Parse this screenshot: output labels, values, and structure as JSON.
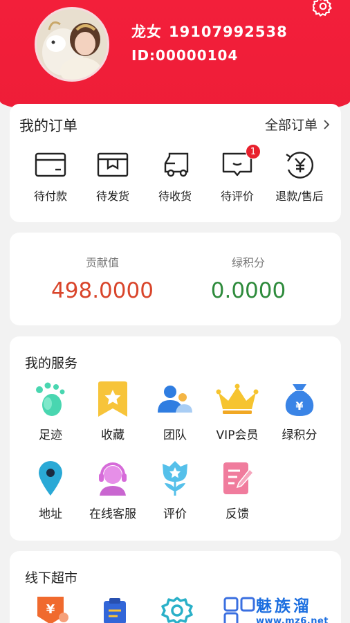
{
  "profile": {
    "name": "龙女",
    "phone": "19107992538",
    "id_text": "ID:00000104"
  },
  "orders": {
    "title": "我的订单",
    "all_label": "全部订单",
    "items": [
      {
        "label": "待付款",
        "icon": "wallet-icon"
      },
      {
        "label": "待发货",
        "icon": "package-icon"
      },
      {
        "label": "待收货",
        "icon": "truck-icon"
      },
      {
        "label": "待评价",
        "icon": "comment-icon",
        "badge": "1"
      },
      {
        "label": "退款/售后",
        "icon": "refund-icon"
      }
    ]
  },
  "points": {
    "contribution_label": "贡献值",
    "contribution_value": "498.0000",
    "green_label": "绿积分",
    "green_value": "0.0000",
    "colors": {
      "contribution": "#d9452b",
      "green": "#2e8b3c"
    }
  },
  "services": {
    "title": "我的服务",
    "items": [
      {
        "label": "足迹",
        "icon": "footprint-icon"
      },
      {
        "label": "收藏",
        "icon": "bookmark-star-icon"
      },
      {
        "label": "团队",
        "icon": "team-icon"
      },
      {
        "label": "VIP会员",
        "icon": "crown-icon"
      },
      {
        "label": "绿积分",
        "icon": "money-bag-icon"
      },
      {
        "label": "地址",
        "icon": "location-pin-icon"
      },
      {
        "label": "在线客服",
        "icon": "customer-service-icon"
      },
      {
        "label": "评价",
        "icon": "flower-icon"
      },
      {
        "label": "反馈",
        "icon": "feedback-icon"
      }
    ]
  },
  "market": {
    "title": "线下超市"
  },
  "watermark": {
    "brand": "魅族溜",
    "url": "www.mz6.net"
  },
  "theme": {
    "header_red": "#ef1e39",
    "badge_red": "#e8202d"
  }
}
